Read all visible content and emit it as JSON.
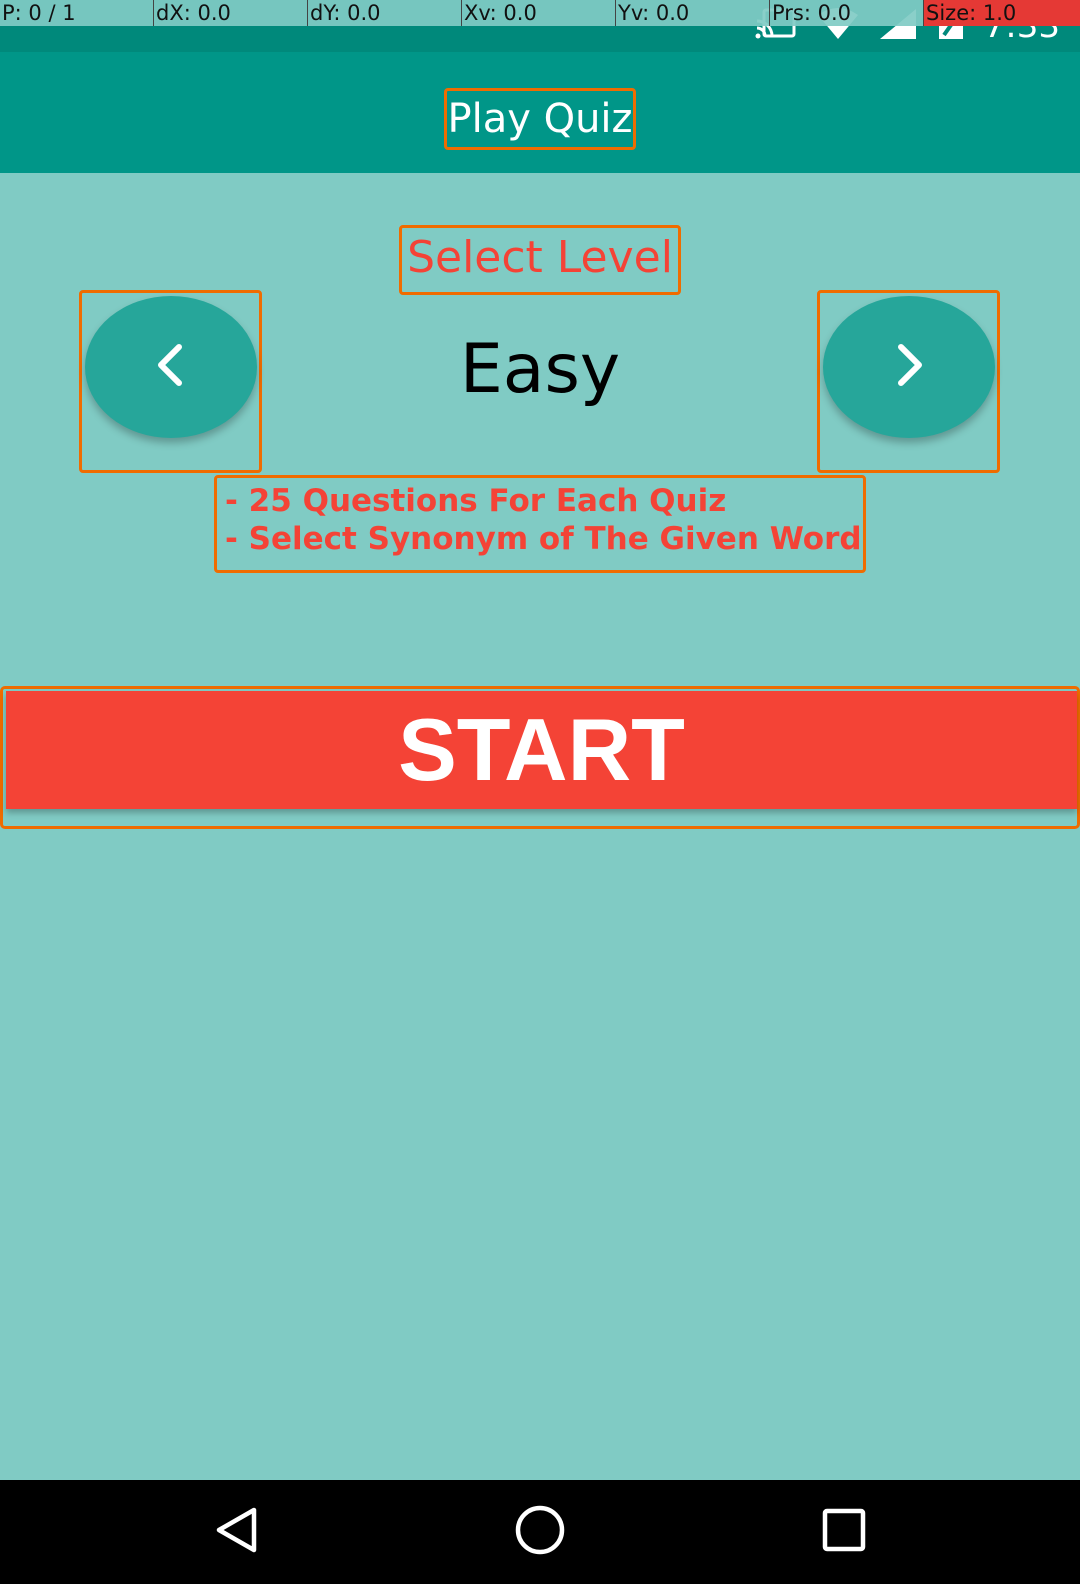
{
  "pointer_overlay": {
    "p": "P: 0 / 1",
    "dx": "dX: 0.0",
    "dy": "dY: 0.0",
    "xv": "Xv: 0.0",
    "yv": "Yv: 0.0",
    "prs": "Prs: 0.0",
    "size": "Size: 1.0"
  },
  "status_bar": {
    "time": "7:33",
    "icons": [
      "cast-icon",
      "wifi-icon",
      "signal-icon",
      "battery-icon"
    ]
  },
  "app_bar": {
    "title": "Play Quiz"
  },
  "level_picker": {
    "heading": "Select Level",
    "current_level": "Easy",
    "prev_icon": "chevron-left-icon",
    "next_icon": "chevron-right-icon"
  },
  "rules": [
    "- 25 Questions For Each Quiz",
    "- Select Synonym of The Given Word"
  ],
  "start_button": {
    "label": "START"
  },
  "colors": {
    "primary": "#009688",
    "background": "#80cbc4",
    "accent": "#f44336",
    "fab": "#26a69a"
  },
  "navigation_bar": {
    "icons": [
      "back-icon",
      "home-icon",
      "recents-icon"
    ]
  }
}
